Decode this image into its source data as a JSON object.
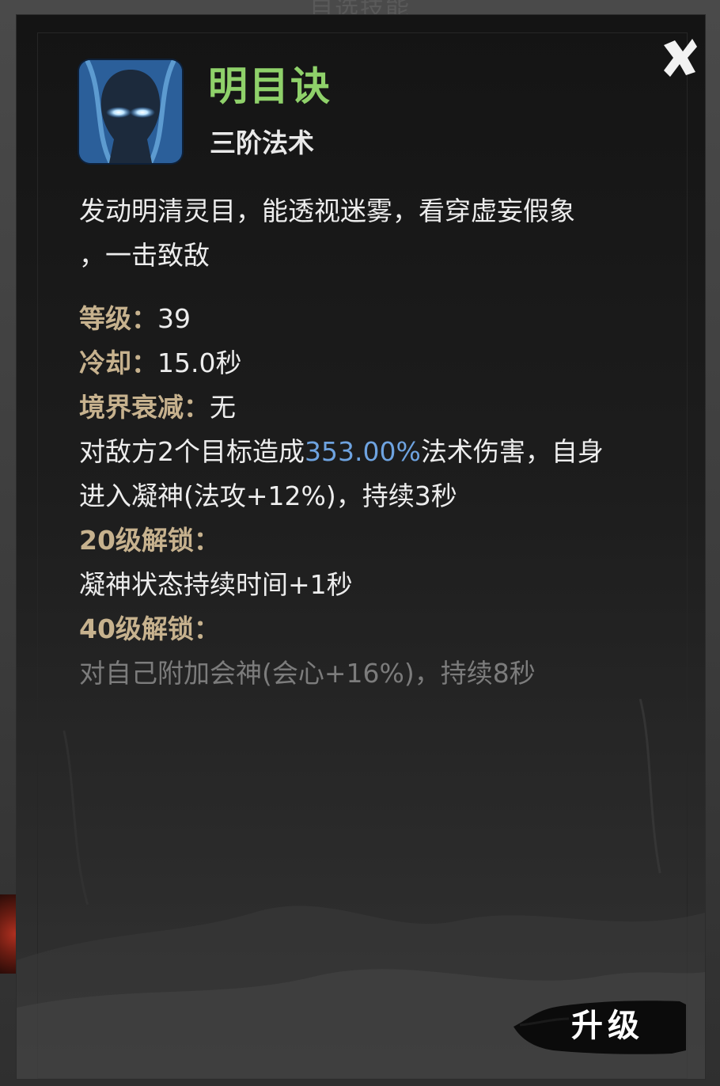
{
  "background": {
    "title": "自选技能"
  },
  "skill": {
    "icon": "glowing-eyes-head-icon",
    "name": "明目诀",
    "tier": "三阶法术",
    "description_line1": "发动明清灵目，能透视迷雾，看穿虚妄假象",
    "description_line2": "，一击致敌"
  },
  "stats": {
    "level_label": "等级：",
    "level_value": "39",
    "cooldown_label": "冷却：",
    "cooldown_value": "15.0秒",
    "realm_decay_label": "境界衰减：",
    "realm_decay_value": "无"
  },
  "effect": {
    "line1_prefix": "对敌方2个目标造成",
    "line1_highlight": "353.00%",
    "line1_suffix": "法术伤害，自身",
    "line2": "进入凝神(法攻+12%)，持续3秒"
  },
  "unlocks": {
    "lv20_label": "20级解锁：",
    "lv20_text": "凝神状态持续时间+1秒",
    "lv40_label": "40级解锁：",
    "lv40_text": "对自己附加会神(会心+16%)，持续8秒"
  },
  "buttons": {
    "upgrade_label": "升级",
    "close_icon": "close-x-icon"
  },
  "colors": {
    "skill_name": "#8fd16a",
    "label_gold": "#c7b28e",
    "highlight_blue": "#6ea3e0",
    "locked_gray": "#7c7c7c"
  }
}
